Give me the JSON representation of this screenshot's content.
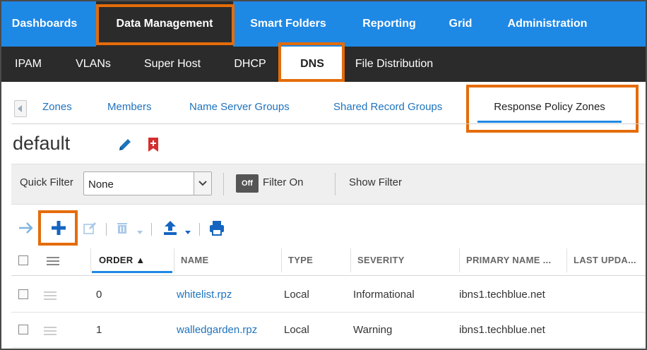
{
  "top_nav": {
    "items": [
      {
        "label": "Dashboards"
      },
      {
        "label": "Data Management"
      },
      {
        "label": "Smart Folders"
      },
      {
        "label": "Reporting"
      },
      {
        "label": "Grid"
      },
      {
        "label": "Administration"
      }
    ],
    "active": "Data Management"
  },
  "sub_nav": {
    "items": [
      {
        "label": "IPAM"
      },
      {
        "label": "VLANs"
      },
      {
        "label": "Super Host"
      },
      {
        "label": "DHCP"
      },
      {
        "label": "DNS"
      },
      {
        "label": "File Distribution"
      }
    ],
    "active": "DNS"
  },
  "tabs": {
    "items": [
      {
        "label": "Zones"
      },
      {
        "label": "Members"
      },
      {
        "label": "Name Server Groups"
      },
      {
        "label": "Shared Record Groups"
      },
      {
        "label": "Response Policy Zones"
      }
    ],
    "active": "Response Policy Zones"
  },
  "page": {
    "title": "default"
  },
  "filter": {
    "quick_filter_label": "Quick Filter",
    "quick_filter_value": "None",
    "toggle_label": "Off",
    "filter_on_label": "Filter On",
    "show_filter_label": "Show Filter"
  },
  "grid": {
    "columns": [
      {
        "label": "ORDER ▲"
      },
      {
        "label": "NAME"
      },
      {
        "label": "TYPE"
      },
      {
        "label": "SEVERITY"
      },
      {
        "label": "PRIMARY NAME ..."
      },
      {
        "label": "LAST UPDA..."
      }
    ],
    "sorted_column": "ORDER",
    "rows": [
      {
        "order": "0",
        "name": "whitelist.rpz",
        "type": "Local",
        "severity": "Informational",
        "primary_name_server": "ibns1.techblue.net",
        "last_updated": ""
      },
      {
        "order": "1",
        "name": "walledgarden.rpz",
        "type": "Local",
        "severity": "Warning",
        "primary_name_server": "ibns1.techblue.net",
        "last_updated": ""
      }
    ]
  },
  "colors": {
    "top_nav_bg": "#1e88e5",
    "dark_nav_bg": "#2b2b2b",
    "highlight": "#e46c0a",
    "link": "#1e73be",
    "bookmark": "#d32f2f"
  }
}
